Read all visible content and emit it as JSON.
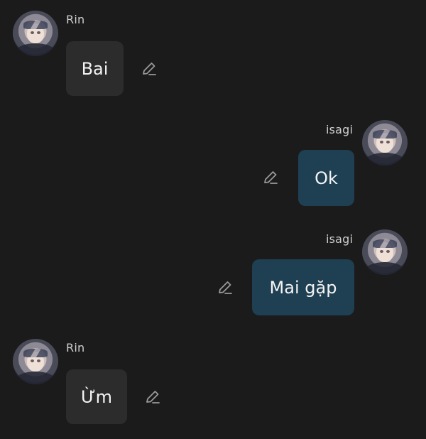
{
  "messages": [
    {
      "sender": "Rin",
      "text": "Bai",
      "direction": "incoming"
    },
    {
      "sender": "isagi",
      "text": "Ok",
      "direction": "outgoing"
    },
    {
      "sender": "isagi",
      "text": "Mai gặp",
      "direction": "outgoing"
    },
    {
      "sender": "Rin",
      "text": "Ừm",
      "direction": "incoming"
    }
  ],
  "icons": {
    "edit": "pencil-edit-icon",
    "avatar": "anime-avatar-image"
  },
  "colors": {
    "background": "#1b1b1b",
    "incoming_bubble": "#2c2c2c",
    "outgoing_bubble": "#1f3f52",
    "text": "#f3f3f3",
    "username": "#cfcfcf",
    "icon": "#9a9a9a"
  }
}
